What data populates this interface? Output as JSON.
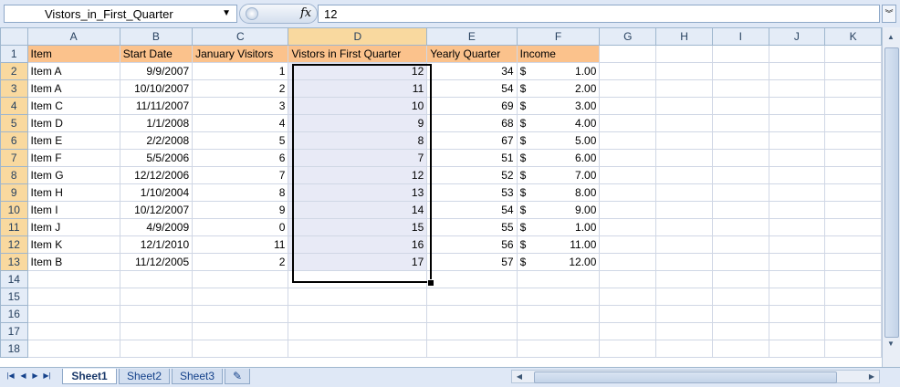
{
  "namebox": {
    "value": "Vistors_in_First_Quarter"
  },
  "formula": {
    "fx_label": "fx",
    "value": "12"
  },
  "columns": [
    "A",
    "B",
    "C",
    "D",
    "E",
    "F",
    "G",
    "H",
    "I",
    "J",
    "K"
  ],
  "rows": [
    "1",
    "2",
    "3",
    "4",
    "5",
    "6",
    "7",
    "8",
    "9",
    "10",
    "11",
    "12",
    "13",
    "14",
    "15",
    "16",
    "17",
    "18"
  ],
  "headers": [
    "Item",
    "Start Date",
    "January Visitors",
    "Vistors in First Quarter",
    "Yearly Quarter",
    "Income"
  ],
  "data": [
    {
      "item": "Item A",
      "start": "9/9/2007",
      "jan": "1",
      "q1": "12",
      "yq": "34",
      "income": "1.00"
    },
    {
      "item": "Item A",
      "start": "10/10/2007",
      "jan": "2",
      "q1": "11",
      "yq": "54",
      "income": "2.00"
    },
    {
      "item": "Item C",
      "start": "11/11/2007",
      "jan": "3",
      "q1": "10",
      "yq": "69",
      "income": "3.00"
    },
    {
      "item": "Item D",
      "start": "1/1/2008",
      "jan": "4",
      "q1": "9",
      "yq": "68",
      "income": "4.00"
    },
    {
      "item": "Item E",
      "start": "2/2/2008",
      "jan": "5",
      "q1": "8",
      "yq": "67",
      "income": "5.00"
    },
    {
      "item": "Item F",
      "start": "5/5/2006",
      "jan": "6",
      "q1": "7",
      "yq": "51",
      "income": "6.00"
    },
    {
      "item": "Item G",
      "start": "12/12/2006",
      "jan": "7",
      "q1": "12",
      "yq": "52",
      "income": "7.00"
    },
    {
      "item": "Item H",
      "start": "1/10/2004",
      "jan": "8",
      "q1": "13",
      "yq": "53",
      "income": "8.00"
    },
    {
      "item": "Item I",
      "start": "10/12/2007",
      "jan": "9",
      "q1": "14",
      "yq": "54",
      "income": "9.00"
    },
    {
      "item": "Item J",
      "start": "4/9/2009",
      "jan": "0",
      "q1": "15",
      "yq": "55",
      "income": "1.00"
    },
    {
      "item": "Item K",
      "start": "12/1/2010",
      "jan": "11",
      "q1": "16",
      "yq": "56",
      "income": "11.00"
    },
    {
      "item": "Item B",
      "start": "11/12/2005",
      "jan": "2",
      "q1": "17",
      "yq": "57",
      "income": "12.00"
    }
  ],
  "currency_symbol": "$",
  "tabs": [
    "Sheet1",
    "Sheet2",
    "Sheet3"
  ],
  "active_tab": "Sheet1",
  "colors": {
    "header_fill": "#fbc28c",
    "selection_fill": "#e8eaf6",
    "heading_selected": "#f9d99f",
    "chrome": "#dfe8f6"
  },
  "icons": [
    "dropdown-arrow-icon",
    "fx-icon",
    "expand-formula-icon",
    "first-sheet-icon",
    "prev-sheet-icon",
    "next-sheet-icon",
    "last-sheet-icon",
    "insert-sheet-icon"
  ]
}
